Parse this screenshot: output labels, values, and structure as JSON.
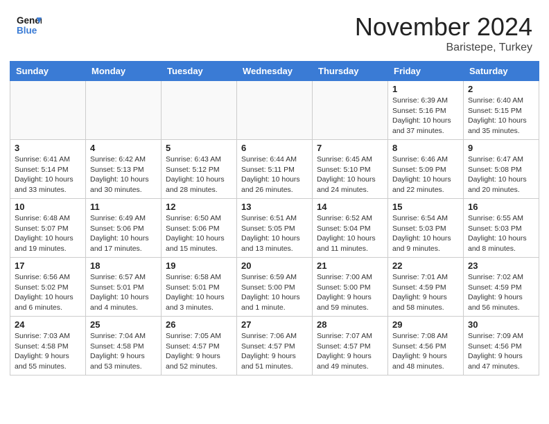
{
  "header": {
    "logo_line1": "General",
    "logo_line2": "Blue",
    "month": "November 2024",
    "location": "Baristepe, Turkey"
  },
  "weekdays": [
    "Sunday",
    "Monday",
    "Tuesday",
    "Wednesday",
    "Thursday",
    "Friday",
    "Saturday"
  ],
  "weeks": [
    [
      {
        "day": "",
        "info": ""
      },
      {
        "day": "",
        "info": ""
      },
      {
        "day": "",
        "info": ""
      },
      {
        "day": "",
        "info": ""
      },
      {
        "day": "",
        "info": ""
      },
      {
        "day": "1",
        "info": "Sunrise: 6:39 AM\nSunset: 5:16 PM\nDaylight: 10 hours and 37 minutes."
      },
      {
        "day": "2",
        "info": "Sunrise: 6:40 AM\nSunset: 5:15 PM\nDaylight: 10 hours and 35 minutes."
      }
    ],
    [
      {
        "day": "3",
        "info": "Sunrise: 6:41 AM\nSunset: 5:14 PM\nDaylight: 10 hours and 33 minutes."
      },
      {
        "day": "4",
        "info": "Sunrise: 6:42 AM\nSunset: 5:13 PM\nDaylight: 10 hours and 30 minutes."
      },
      {
        "day": "5",
        "info": "Sunrise: 6:43 AM\nSunset: 5:12 PM\nDaylight: 10 hours and 28 minutes."
      },
      {
        "day": "6",
        "info": "Sunrise: 6:44 AM\nSunset: 5:11 PM\nDaylight: 10 hours and 26 minutes."
      },
      {
        "day": "7",
        "info": "Sunrise: 6:45 AM\nSunset: 5:10 PM\nDaylight: 10 hours and 24 minutes."
      },
      {
        "day": "8",
        "info": "Sunrise: 6:46 AM\nSunset: 5:09 PM\nDaylight: 10 hours and 22 minutes."
      },
      {
        "day": "9",
        "info": "Sunrise: 6:47 AM\nSunset: 5:08 PM\nDaylight: 10 hours and 20 minutes."
      }
    ],
    [
      {
        "day": "10",
        "info": "Sunrise: 6:48 AM\nSunset: 5:07 PM\nDaylight: 10 hours and 19 minutes."
      },
      {
        "day": "11",
        "info": "Sunrise: 6:49 AM\nSunset: 5:06 PM\nDaylight: 10 hours and 17 minutes."
      },
      {
        "day": "12",
        "info": "Sunrise: 6:50 AM\nSunset: 5:06 PM\nDaylight: 10 hours and 15 minutes."
      },
      {
        "day": "13",
        "info": "Sunrise: 6:51 AM\nSunset: 5:05 PM\nDaylight: 10 hours and 13 minutes."
      },
      {
        "day": "14",
        "info": "Sunrise: 6:52 AM\nSunset: 5:04 PM\nDaylight: 10 hours and 11 minutes."
      },
      {
        "day": "15",
        "info": "Sunrise: 6:54 AM\nSunset: 5:03 PM\nDaylight: 10 hours and 9 minutes."
      },
      {
        "day": "16",
        "info": "Sunrise: 6:55 AM\nSunset: 5:03 PM\nDaylight: 10 hours and 8 minutes."
      }
    ],
    [
      {
        "day": "17",
        "info": "Sunrise: 6:56 AM\nSunset: 5:02 PM\nDaylight: 10 hours and 6 minutes."
      },
      {
        "day": "18",
        "info": "Sunrise: 6:57 AM\nSunset: 5:01 PM\nDaylight: 10 hours and 4 minutes."
      },
      {
        "day": "19",
        "info": "Sunrise: 6:58 AM\nSunset: 5:01 PM\nDaylight: 10 hours and 3 minutes."
      },
      {
        "day": "20",
        "info": "Sunrise: 6:59 AM\nSunset: 5:00 PM\nDaylight: 10 hours and 1 minute."
      },
      {
        "day": "21",
        "info": "Sunrise: 7:00 AM\nSunset: 5:00 PM\nDaylight: 9 hours and 59 minutes."
      },
      {
        "day": "22",
        "info": "Sunrise: 7:01 AM\nSunset: 4:59 PM\nDaylight: 9 hours and 58 minutes."
      },
      {
        "day": "23",
        "info": "Sunrise: 7:02 AM\nSunset: 4:59 PM\nDaylight: 9 hours and 56 minutes."
      }
    ],
    [
      {
        "day": "24",
        "info": "Sunrise: 7:03 AM\nSunset: 4:58 PM\nDaylight: 9 hours and 55 minutes."
      },
      {
        "day": "25",
        "info": "Sunrise: 7:04 AM\nSunset: 4:58 PM\nDaylight: 9 hours and 53 minutes."
      },
      {
        "day": "26",
        "info": "Sunrise: 7:05 AM\nSunset: 4:57 PM\nDaylight: 9 hours and 52 minutes."
      },
      {
        "day": "27",
        "info": "Sunrise: 7:06 AM\nSunset: 4:57 PM\nDaylight: 9 hours and 51 minutes."
      },
      {
        "day": "28",
        "info": "Sunrise: 7:07 AM\nSunset: 4:57 PM\nDaylight: 9 hours and 49 minutes."
      },
      {
        "day": "29",
        "info": "Sunrise: 7:08 AM\nSunset: 4:56 PM\nDaylight: 9 hours and 48 minutes."
      },
      {
        "day": "30",
        "info": "Sunrise: 7:09 AM\nSunset: 4:56 PM\nDaylight: 9 hours and 47 minutes."
      }
    ]
  ]
}
